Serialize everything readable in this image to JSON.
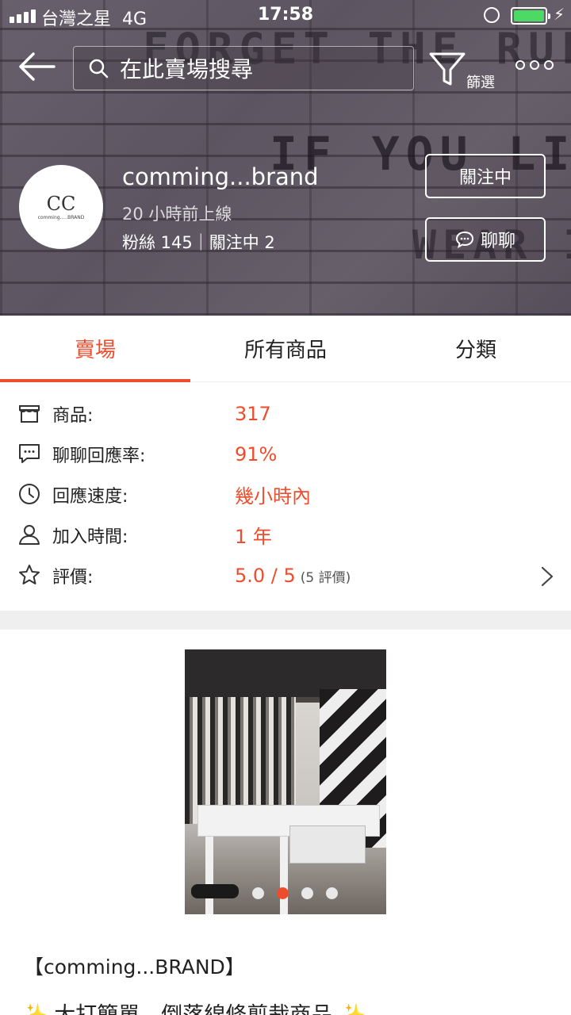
{
  "status_bar": {
    "carrier": "台灣之星",
    "network": "4G",
    "time": "17:58"
  },
  "nav": {
    "search_placeholder": "在此賣場搜尋",
    "filter_label": "篩選"
  },
  "hero_wall_text": {
    "line1": "FORGET THE RULES",
    "line2": "IF YOU LIKE IT",
    "line3": "WEAR IT"
  },
  "shop": {
    "avatar_mark": "CC",
    "avatar_text": "comming.....BRAND",
    "name": "comming...brand",
    "online_status": "20 小時前上線",
    "followers_stats": "粉絲 145｜關注中 2",
    "follow_button": "關注中",
    "chat_button": "聊聊"
  },
  "tabs": [
    {
      "label": "賣場",
      "active": true
    },
    {
      "label": "所有商品",
      "active": false
    },
    {
      "label": "分類",
      "active": false
    }
  ],
  "info_rows": {
    "products": {
      "label": "商品:",
      "value": "317",
      "icon": "shop-icon"
    },
    "chat_rate": {
      "label": "聊聊回應率:",
      "value": "91%",
      "icon": "chat-bubble-icon"
    },
    "response_speed": {
      "label": "回應速度:",
      "value": "幾小時內",
      "icon": "clock-icon"
    },
    "joined": {
      "label": "加入時間:",
      "value": "1 年",
      "icon": "user-icon"
    },
    "rating": {
      "label": "評價:",
      "value": "5.0 / 5",
      "extra": "(5 評價)",
      "icon": "star-icon"
    }
  },
  "carousel": {
    "count": 4,
    "active_index": 1
  },
  "description": {
    "title": "【comming...BRAND】",
    "line1": "大打簡單，倒落線條剪裁商品"
  },
  "colors": {
    "accent": "#ee4d2d",
    "battery": "#4cd964"
  }
}
